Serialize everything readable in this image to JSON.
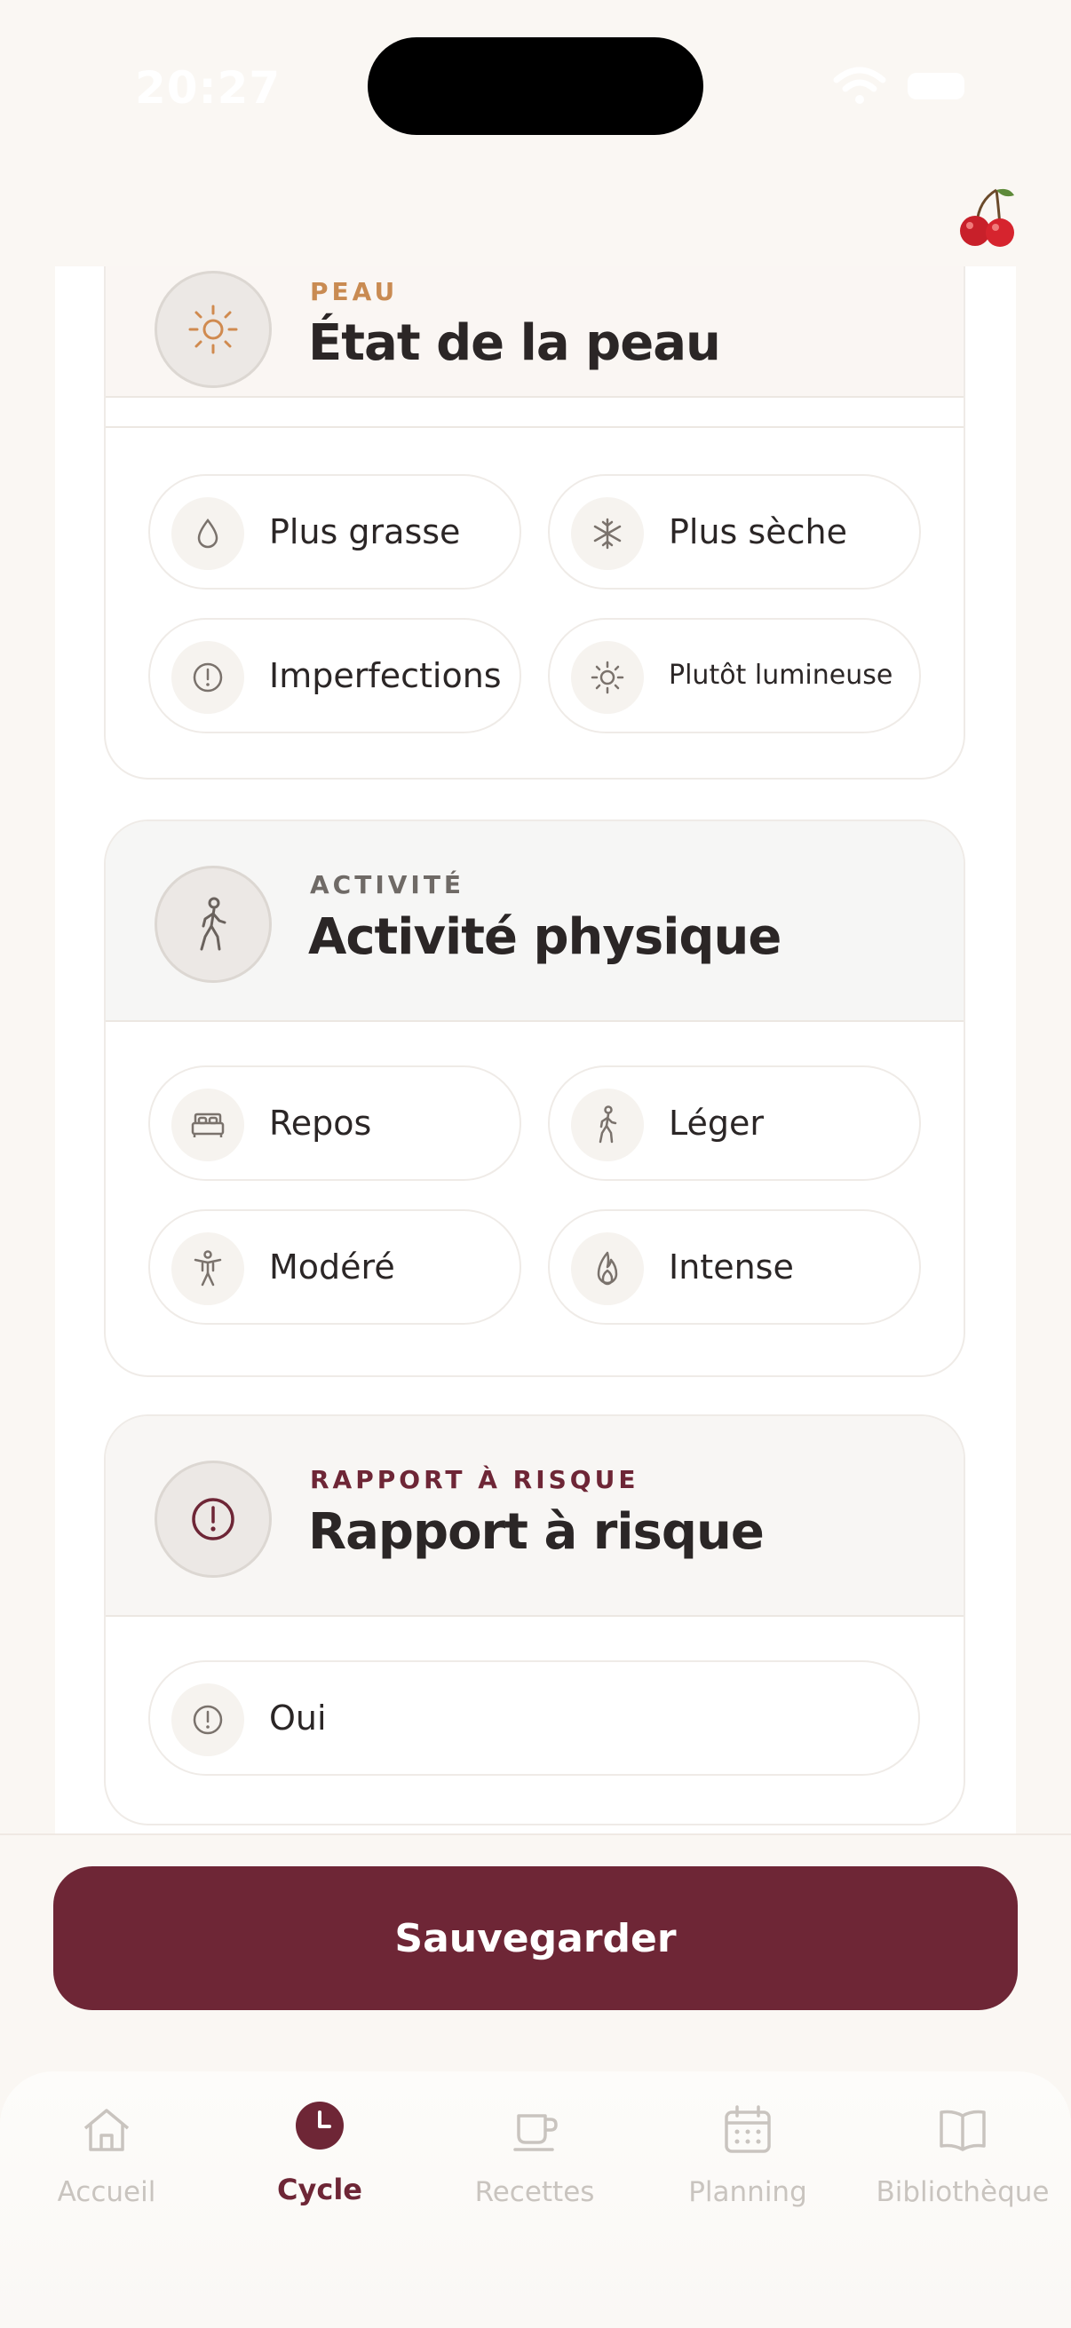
{
  "status": {
    "time": "20:27"
  },
  "sections": [
    {
      "eyebrow": "PEAU",
      "eyebrow_color": "#c98b52",
      "title": "État de la peau",
      "header_bg": "#faf6f3",
      "icon": "sun-icon",
      "options": [
        {
          "label": "Plus grasse",
          "icon": "droplet-icon"
        },
        {
          "label": "Plus sèche",
          "icon": "snowflake-icon"
        },
        {
          "label": "Imperfections",
          "icon": "alert-circle-icon"
        },
        {
          "label": "Plutôt lumineuse",
          "icon": "sun-icon"
        }
      ]
    },
    {
      "eyebrow": "ACTIVITÉ",
      "eyebrow_color": "#6f6a66",
      "title": "Activité physique",
      "header_bg": "#f6f6f5",
      "icon": "walking-person-icon",
      "options": [
        {
          "label": "Repos",
          "icon": "bed-icon"
        },
        {
          "label": "Léger",
          "icon": "walking-person-icon"
        },
        {
          "label": "Modéré",
          "icon": "person-stretching-icon"
        },
        {
          "label": "Intense",
          "icon": "flame-icon"
        }
      ]
    },
    {
      "eyebrow": "RAPPORT À RISQUE",
      "eyebrow_color": "#6e2636",
      "title": "Rapport à risque",
      "header_bg": "#f8f6f4",
      "icon": "alert-circle-icon",
      "options": [
        {
          "label": "Oui",
          "icon": "alert-circle-icon"
        }
      ]
    }
  ],
  "save_label": "Sauvegarder",
  "tabs": [
    {
      "label": "Accueil",
      "icon": "home-icon",
      "active": false
    },
    {
      "label": "Cycle",
      "icon": "clock-icon",
      "active": true
    },
    {
      "label": "Recettes",
      "icon": "cup-icon",
      "active": false
    },
    {
      "label": "Planning",
      "icon": "calendar-icon",
      "active": false
    },
    {
      "label": "Bibliothèque",
      "icon": "book-icon",
      "active": false
    }
  ],
  "colors": {
    "accent": "#6e2636",
    "background": "#faf7f3",
    "muted": "#c9c4bf"
  }
}
